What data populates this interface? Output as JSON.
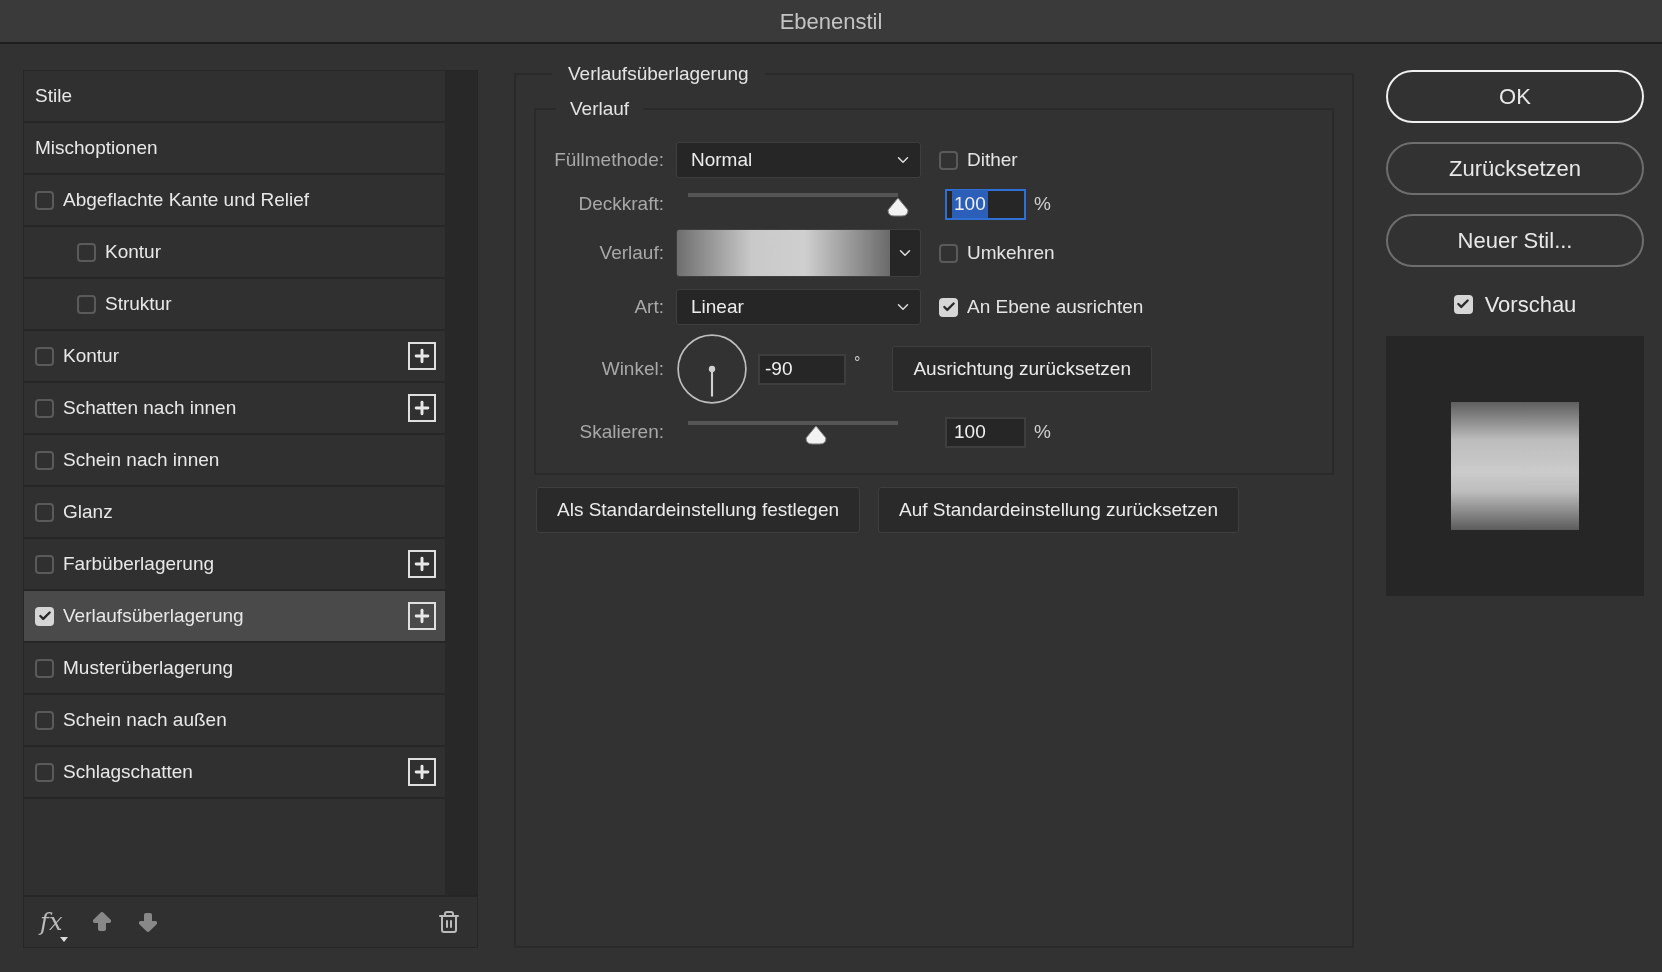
{
  "window": {
    "title": "Ebenenstil"
  },
  "styles_list": {
    "items": [
      {
        "kind": "header",
        "label": "Stile",
        "selected": false
      },
      {
        "kind": "header",
        "label": "Mischoptionen",
        "selected": false
      },
      {
        "kind": "option",
        "label": "Abgeflachte Kante und Relief",
        "checked": false,
        "selected": false,
        "add_button": false,
        "children": [
          {
            "kind": "option",
            "label": "Kontur",
            "checked": false,
            "selected": false,
            "add_button": false
          },
          {
            "kind": "option",
            "label": "Struktur",
            "checked": false,
            "selected": false,
            "add_button": false
          }
        ]
      },
      {
        "kind": "option",
        "label": "Kontur",
        "checked": false,
        "selected": false,
        "add_button": true
      },
      {
        "kind": "option",
        "label": "Schatten nach innen",
        "checked": false,
        "selected": false,
        "add_button": true
      },
      {
        "kind": "option",
        "label": "Schein nach innen",
        "checked": false,
        "selected": false,
        "add_button": false
      },
      {
        "kind": "option",
        "label": "Glanz",
        "checked": false,
        "selected": false,
        "add_button": false
      },
      {
        "kind": "option",
        "label": "Farbüberlagerung",
        "checked": false,
        "selected": false,
        "add_button": true
      },
      {
        "kind": "option",
        "label": "Verlaufsüberlagerung",
        "checked": true,
        "selected": true,
        "add_button": true
      },
      {
        "kind": "option",
        "label": "Musterüberlagerung",
        "checked": false,
        "selected": false,
        "add_button": false
      },
      {
        "kind": "option",
        "label": "Schein nach außen",
        "checked": false,
        "selected": false,
        "add_button": false
      },
      {
        "kind": "option",
        "label": "Schlagschatten",
        "checked": false,
        "selected": false,
        "add_button": true
      }
    ],
    "footer": {
      "fx_label": "fx"
    }
  },
  "settings": {
    "title": "Verlaufsüberlagerung",
    "group_title": "Verlauf",
    "fill_method": {
      "label": "Füllmethode:",
      "value": "Normal"
    },
    "dither": {
      "label": "Dither",
      "checked": false
    },
    "opacity": {
      "label": "Deckkraft:",
      "level": 1.0,
      "value": "100",
      "unit": "%",
      "focused": true
    },
    "gradient": {
      "label": "Verlauf:"
    },
    "reverse": {
      "label": "Umkehren",
      "checked": false
    },
    "style": {
      "label": "Art:",
      "value": "Linear"
    },
    "align": {
      "label": "An Ebene ausrichten",
      "checked": true
    },
    "angle": {
      "label": "Winkel:",
      "value": "-90",
      "unit": "°"
    },
    "reset_alignment": "Ausrichtung zurücksetzen",
    "scale": {
      "label": "Skalieren:",
      "level": 0.61,
      "value": "100",
      "unit": "%",
      "focused": false
    },
    "buttons": [
      "Als Standardeinstellung festlegen",
      "Auf Standardeinstellung zurücksetzen"
    ]
  },
  "actions": [
    {
      "label": "OK",
      "default": true
    },
    {
      "label": "Zurücksetzen",
      "default": false
    },
    {
      "label": "Neuer Stil...",
      "default": false
    }
  ],
  "preview": {
    "label": "Vorschau",
    "checked": true
  }
}
